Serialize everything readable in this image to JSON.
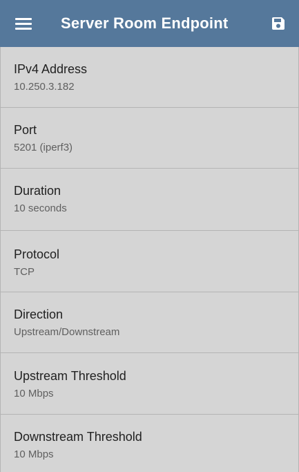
{
  "header": {
    "title": "Server Room Endpoint",
    "menu_icon": "hamburger-menu-icon",
    "save_icon": "floppy-disk-save-icon",
    "background_color": "#55789b"
  },
  "settings": [
    {
      "label": "IPv4 Address",
      "value": "10.250.3.182"
    },
    {
      "label": "Port",
      "value": "5201 (iperf3)"
    },
    {
      "label": "Duration",
      "value": "10 seconds"
    },
    {
      "label": "Protocol",
      "value": "TCP"
    },
    {
      "label": "Direction",
      "value": "Upstream/Downstream"
    },
    {
      "label": "Upstream Threshold",
      "value": "10 Mbps"
    },
    {
      "label": "Downstream Threshold",
      "value": "10 Mbps"
    }
  ]
}
